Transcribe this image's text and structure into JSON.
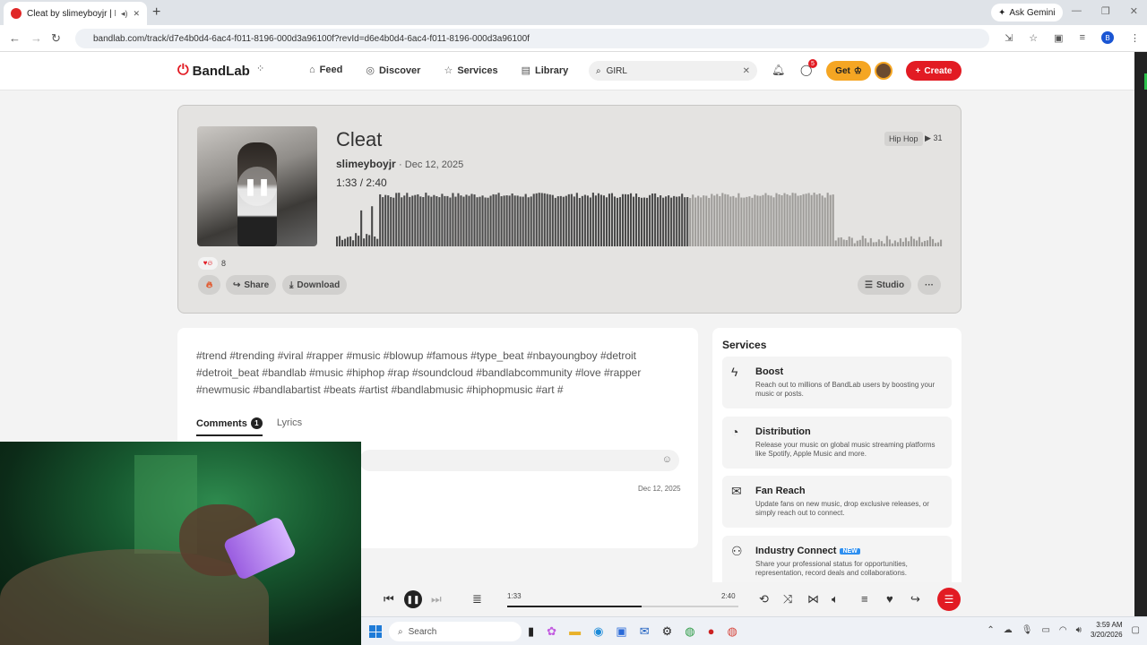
{
  "browser": {
    "tab_title": "Cleat by slimeyboyjr | BandLab",
    "new_tab_symbol": "+",
    "gemini_label": "Ask Gemini",
    "url": "bandlab.com/track/d7e4b0d4-6ac4-f011-8196-000d3a96100f?revId=d6e4b0d4-6ac4-f011-8196-000d3a96100f",
    "profile_initial": "B"
  },
  "header": {
    "logo": "BandLab",
    "nav": [
      {
        "label": "Feed",
        "icon": "home-icon"
      },
      {
        "label": "Discover",
        "icon": "compass-icon"
      },
      {
        "label": "Services",
        "icon": "star-icon"
      },
      {
        "label": "Library",
        "icon": "library-icon"
      }
    ],
    "search_value": "GIRL",
    "messages_badge": "5",
    "get_label": "Get",
    "create_label": "Create"
  },
  "track": {
    "title": "Cleat",
    "artist": "slimeyboyjr",
    "date": "· Dec 12, 2025",
    "time": "1:33 /  2:40",
    "genre": "Hip Hop",
    "plays": "31",
    "likes": "8",
    "share_label": "Share",
    "download_label": "Download",
    "studio_label": "Studio",
    "progress": 0.58
  },
  "tags": "#trend #trending #viral #rapper #music #blowup #famous #type_beat #nbayoungboy #detroit #detroit_beat #bandlab   #music #hiphop #rap #soundcloud #bandlabcommunity #love #rapper #newmusic #bandlabartist #beats #artist #bandlabmusic #hiphopmusic #art #",
  "comments": {
    "tab_comments": "Comments",
    "count": "1",
    "tab_lyrics": "Lyrics",
    "date": "Dec 12, 2025"
  },
  "services": {
    "title": "Services",
    "items": [
      {
        "name": "Boost",
        "desc": "Reach out to millions of BandLab users by boosting your music or posts.",
        "icon": "bolt-icon"
      },
      {
        "name": "Distribution",
        "desc": "Release your music on global music streaming platforms like Spotify, Apple Music and more.",
        "icon": "distribution-icon"
      },
      {
        "name": "Fan Reach",
        "desc": "Update fans on new music, drop exclusive releases, or simply reach out to connect.",
        "icon": "mail-icon"
      },
      {
        "name": "Industry Connect",
        "desc": "Share your professional status for opportunities, representation, record deals and collaborations.",
        "icon": "people-icon",
        "badge": "NEW"
      }
    ]
  },
  "player": {
    "current": "1:33",
    "total": "2:40",
    "progress": 0.58
  },
  "taskbar": {
    "search": "Search",
    "time": "3:59 AM",
    "date": "3/20/2026"
  },
  "colors": {
    "brand": "#e21b23",
    "get_button": "#f5a623",
    "wave_played": "#4a4a4a",
    "wave_unplayed": "#9d9b98"
  }
}
